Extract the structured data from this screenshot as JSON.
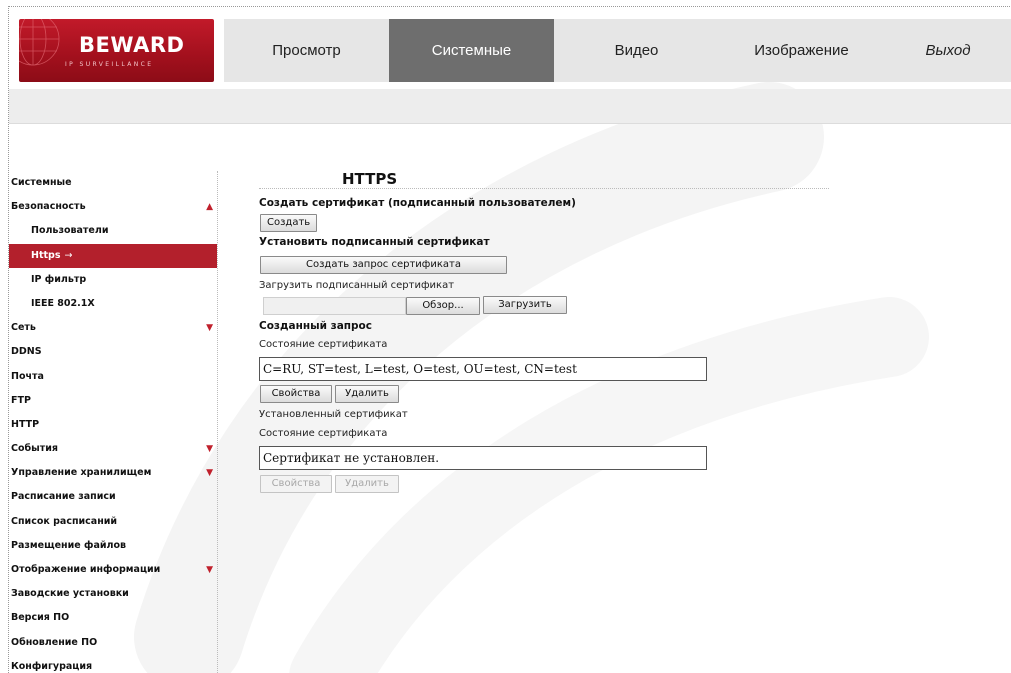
{
  "header": {
    "logo": {
      "brand": "BEWARD",
      "tagline": "IP SURVEILLANCE"
    },
    "tabs": [
      {
        "label": "Просмотр",
        "active": false
      },
      {
        "label": "Системные",
        "active": true
      },
      {
        "label": "Видео",
        "active": false
      },
      {
        "label": "Изображение",
        "active": false
      },
      {
        "label": "Выход",
        "active": false
      }
    ]
  },
  "sidebar": {
    "items": [
      {
        "label": "Системные",
        "sub": false,
        "arrow": ""
      },
      {
        "label": "Безопасность",
        "sub": false,
        "arrow": "▲"
      },
      {
        "label": "Пользователи",
        "sub": true,
        "arrow": ""
      },
      {
        "label": "Https",
        "sub": true,
        "arrow": "",
        "active": true,
        "mark": "→"
      },
      {
        "label": "IP фильтр",
        "sub": true,
        "arrow": ""
      },
      {
        "label": "IEEE 802.1X",
        "sub": true,
        "arrow": ""
      },
      {
        "label": "Сеть",
        "sub": false,
        "arrow": "▼"
      },
      {
        "label": "DDNS",
        "sub": false,
        "arrow": ""
      },
      {
        "label": "Почта",
        "sub": false,
        "arrow": ""
      },
      {
        "label": "FTP",
        "sub": false,
        "arrow": ""
      },
      {
        "label": "HTTP",
        "sub": false,
        "arrow": ""
      },
      {
        "label": "События",
        "sub": false,
        "arrow": "▼"
      },
      {
        "label": "Управление хранилищем",
        "sub": false,
        "arrow": "▼"
      },
      {
        "label": "Расписание записи",
        "sub": false,
        "arrow": ""
      },
      {
        "label": "Список расписаний",
        "sub": false,
        "arrow": ""
      },
      {
        "label": "Размещение файлов",
        "sub": false,
        "arrow": ""
      },
      {
        "label": "Отображение информации",
        "sub": false,
        "arrow": "▼"
      },
      {
        "label": "Заводские установки",
        "sub": false,
        "arrow": ""
      },
      {
        "label": "Версия ПО",
        "sub": false,
        "arrow": ""
      },
      {
        "label": "Обновление ПО",
        "sub": false,
        "arrow": ""
      },
      {
        "label": "Конфигурация",
        "sub": false,
        "arrow": ""
      }
    ]
  },
  "main": {
    "title": "HTTPS",
    "create_section": "Создать сертификат (подписанный пользователем)",
    "create_button": "Создать",
    "install_section": "Установить подписанный сертификат",
    "request_button": "Создать запрос сертификата",
    "upload_label": "Загрузить подписанный сертификат",
    "browse_button": "Обзор...",
    "upload_button": "Загрузить",
    "created_request_section": "Созданный запрос",
    "cert_status_label_1": "Состояние сертификата",
    "cert_status_value_1": "C=RU, ST=test, L=test, O=test, OU=test, CN=test",
    "properties_button_1": "Свойства",
    "delete_button_1": "Удалить",
    "installed_cert_label": "Установленный сертификат",
    "cert_status_label_2": "Состояние сертификата",
    "cert_status_value_2": "Сертификат не установлен.",
    "properties_button_2": "Свойства",
    "delete_button_2": "Удалить"
  },
  "colors": {
    "accent": "#b3202c",
    "active_tab": "#6e6e6e",
    "nav_bg": "#e6e6e6"
  }
}
